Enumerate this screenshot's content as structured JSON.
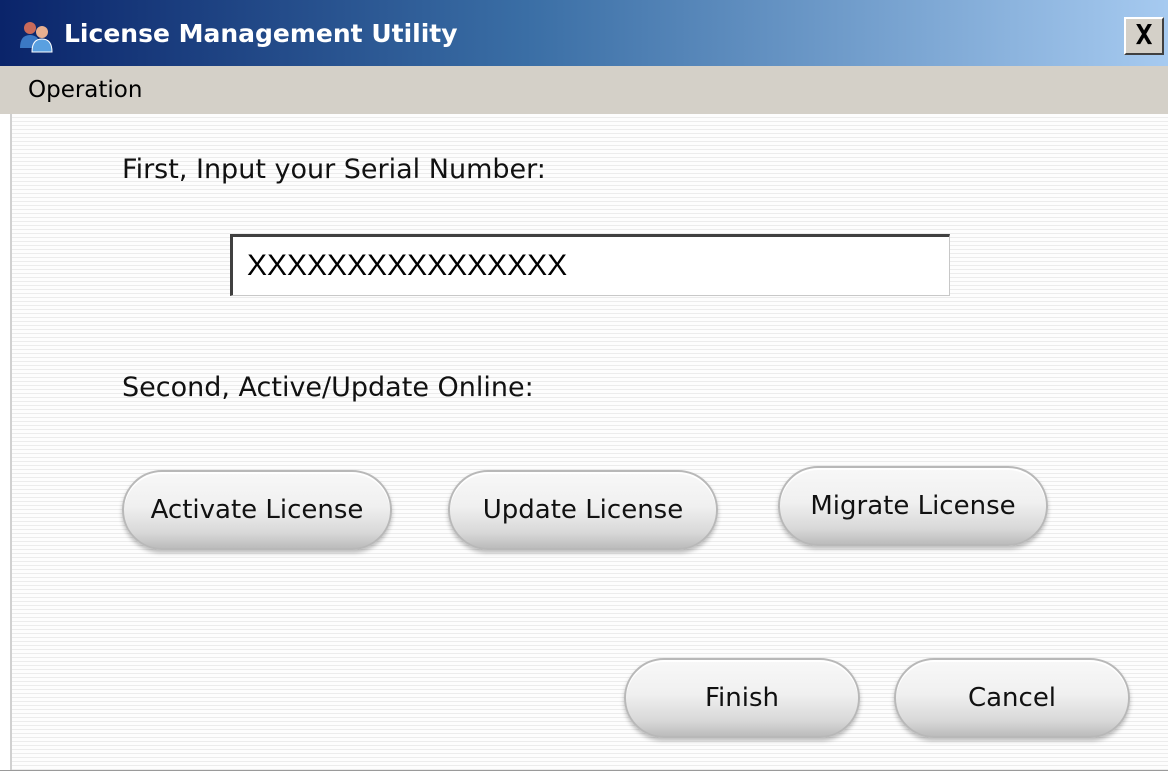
{
  "window": {
    "title": "License Management Utility",
    "close_label": "X",
    "icon": "app-users-icon"
  },
  "menu": {
    "items": [
      {
        "label": "Operation"
      }
    ]
  },
  "form": {
    "serial_label": "First, Input your Serial Number:",
    "serial_value": "XXXXXXXXXXXXXXXX",
    "online_label": "Second, Active/Update Online:",
    "buttons": {
      "activate": "Activate License",
      "update": "Update License",
      "migrate": "Migrate License",
      "finish": "Finish",
      "cancel": "Cancel"
    }
  },
  "colors": {
    "title_gradient_start": "#0a246a",
    "title_gradient_end": "#a6caf0",
    "menu_bg": "#d4d0c8"
  }
}
